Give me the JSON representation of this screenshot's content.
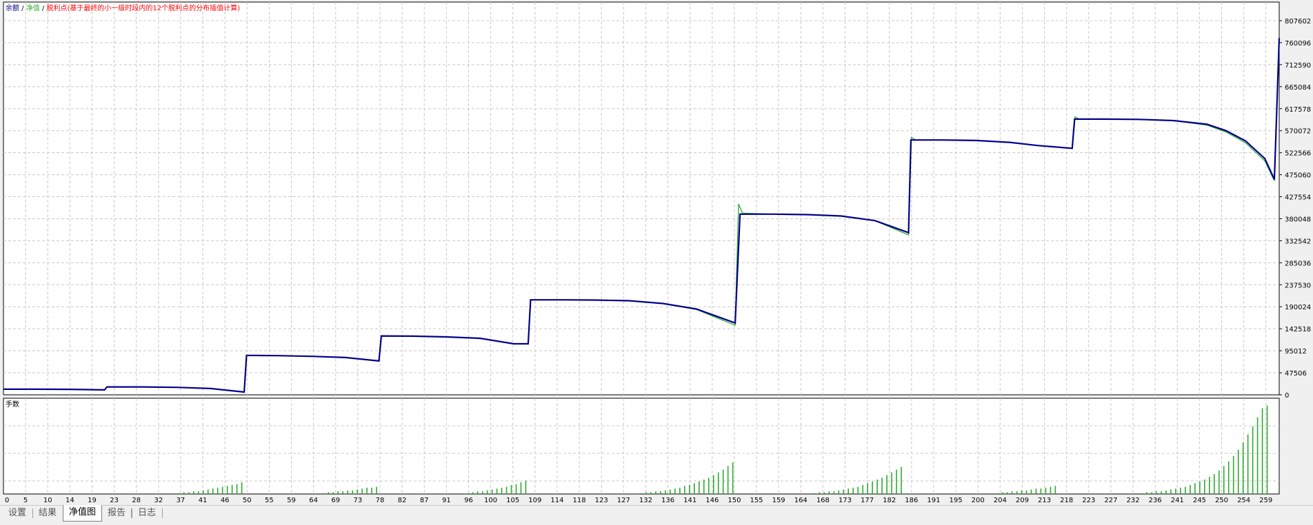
{
  "chart_data": [
    {
      "type": "line",
      "legend": [
        "余额",
        "净值",
        "脱利点(基于最终的小一级时段内的12个脱利点的分布插值计算)"
      ],
      "colors": {
        "balance": "#00008b",
        "equity": "#2ea82e",
        "legend_sep": "#000000",
        "legend_note": "#ff0000"
      },
      "grid": true,
      "x_ticks": [
        "0",
        "5",
        "10",
        "14",
        "19",
        "23",
        "28",
        "32",
        "37",
        "41",
        "46",
        "50",
        "55",
        "59",
        "64",
        "69",
        "73",
        "78",
        "82",
        "87",
        "91",
        "96",
        "100",
        "105",
        "109",
        "114",
        "118",
        "123",
        "127",
        "132",
        "136",
        "141",
        "146",
        "150",
        "155",
        "159",
        "164",
        "168",
        "173",
        "177",
        "182",
        "186",
        "191",
        "195",
        "200",
        "204",
        "209",
        "213",
        "218",
        "223",
        "227",
        "232",
        "236",
        "241",
        "245",
        "250",
        "254",
        "259"
      ],
      "x_range": [
        0,
        265
      ],
      "y_ticks": [
        "807602",
        "760096",
        "712590",
        "665084",
        "617578",
        "570072",
        "522566",
        "475060",
        "427554",
        "380048",
        "332542",
        "285036",
        "237530",
        "190024",
        "142518",
        "95012",
        "47506",
        "0"
      ],
      "ylim": [
        0,
        807602
      ],
      "balance": {
        "x": [
          0,
          7,
          14,
          21,
          21.5,
          29,
          36,
          43,
          50,
          50.5,
          57,
          64,
          71,
          78,
          78.5,
          85,
          92,
          99,
          106,
          109,
          109.5,
          116,
          123,
          130,
          137,
          144,
          152,
          153,
          160,
          167,
          174,
          181,
          188,
          188.5,
          195,
          202,
          209,
          215,
          222,
          222.5,
          229,
          236,
          243,
          250,
          254,
          258,
          262,
          264,
          265
        ],
        "y": [
          12000,
          12000,
          11800,
          10500,
          17000,
          17000,
          16000,
          13500,
          6000,
          85000,
          84500,
          83000,
          80500,
          73000,
          127000,
          126500,
          125000,
          122000,
          110000,
          110000,
          205000,
          205000,
          204500,
          203000,
          197000,
          185000,
          155000,
          390000,
          390000,
          389000,
          386000,
          376000,
          350000,
          550000,
          550000,
          549000,
          545000,
          538000,
          532000,
          595000,
          595000,
          594500,
          592000,
          584000,
          570000,
          548000,
          510000,
          465000,
          770000
        ]
      },
      "equity": {
        "x": [
          0,
          7,
          14,
          21,
          21.5,
          29,
          36,
          43,
          50,
          50.5,
          57,
          64,
          71,
          78,
          78.5,
          85,
          92,
          99,
          106,
          109,
          109.5,
          116,
          123,
          130,
          137,
          144,
          152,
          152.7,
          153.5,
          160,
          167,
          174,
          181,
          188,
          188.6,
          189.5,
          195,
          202,
          209,
          215,
          222,
          222.6,
          223.5,
          229,
          236,
          243,
          250,
          254,
          258,
          262,
          264,
          265
        ],
        "y": [
          12000,
          12000,
          11800,
          10500,
          17000,
          17000,
          16000,
          13500,
          6000,
          85000,
          84500,
          83000,
          80500,
          73000,
          127000,
          126500,
          125000,
          122000,
          110000,
          110000,
          205000,
          205000,
          204500,
          203000,
          197000,
          184000,
          150000,
          412000,
          392000,
          390000,
          389000,
          386000,
          376000,
          345000,
          556000,
          550000,
          550000,
          549000,
          545000,
          538000,
          532000,
          600000,
          595000,
          595000,
          594500,
          592000,
          582000,
          567000,
          544000,
          505000,
          462000,
          770000
        ]
      },
      "title": ""
    },
    {
      "type": "bar",
      "label": "手数",
      "color": "#2ea82e",
      "ylim": [
        0,
        100
      ],
      "bars": [
        {
          "x": 36.5,
          "v": 1
        },
        {
          "x": 37.5,
          "v": 2
        },
        {
          "x": 38.5,
          "v": 2
        },
        {
          "x": 39.5,
          "v": 3
        },
        {
          "x": 40.5,
          "v": 3
        },
        {
          "x": 41.5,
          "v": 4
        },
        {
          "x": 42.5,
          "v": 5
        },
        {
          "x": 43.5,
          "v": 6
        },
        {
          "x": 44.5,
          "v": 7
        },
        {
          "x": 45.5,
          "v": 8
        },
        {
          "x": 46.5,
          "v": 9
        },
        {
          "x": 47.5,
          "v": 10
        },
        {
          "x": 48.5,
          "v": 11
        },
        {
          "x": 49.5,
          "v": 13
        },
        {
          "x": 66.5,
          "v": 1
        },
        {
          "x": 67.5,
          "v": 2
        },
        {
          "x": 68.5,
          "v": 2
        },
        {
          "x": 69.5,
          "v": 3
        },
        {
          "x": 70.5,
          "v": 3
        },
        {
          "x": 71.5,
          "v": 4
        },
        {
          "x": 72.5,
          "v": 4
        },
        {
          "x": 73.5,
          "v": 5
        },
        {
          "x": 74.5,
          "v": 6
        },
        {
          "x": 75.5,
          "v": 7
        },
        {
          "x": 76.5,
          "v": 7
        },
        {
          "x": 77.5,
          "v": 8
        },
        {
          "x": 96.5,
          "v": 1
        },
        {
          "x": 97.5,
          "v": 2
        },
        {
          "x": 98.5,
          "v": 3
        },
        {
          "x": 99.5,
          "v": 3
        },
        {
          "x": 100.5,
          "v": 4
        },
        {
          "x": 101.5,
          "v": 5
        },
        {
          "x": 102.5,
          "v": 6
        },
        {
          "x": 103.5,
          "v": 7
        },
        {
          "x": 104.5,
          "v": 8
        },
        {
          "x": 105.5,
          "v": 10
        },
        {
          "x": 106.5,
          "v": 11
        },
        {
          "x": 107.5,
          "v": 13
        },
        {
          "x": 108.5,
          "v": 15
        },
        {
          "x": 132.5,
          "v": 1
        },
        {
          "x": 133.5,
          "v": 2
        },
        {
          "x": 134.5,
          "v": 2
        },
        {
          "x": 135.5,
          "v": 3
        },
        {
          "x": 136.5,
          "v": 3
        },
        {
          "x": 137.5,
          "v": 4
        },
        {
          "x": 138.5,
          "v": 5
        },
        {
          "x": 139.5,
          "v": 6
        },
        {
          "x": 140.5,
          "v": 7
        },
        {
          "x": 141.5,
          "v": 9
        },
        {
          "x": 142.5,
          "v": 10
        },
        {
          "x": 143.5,
          "v": 12
        },
        {
          "x": 144.5,
          "v": 14
        },
        {
          "x": 145.5,
          "v": 16
        },
        {
          "x": 146.5,
          "v": 18
        },
        {
          "x": 147.5,
          "v": 21
        },
        {
          "x": 148.5,
          "v": 24
        },
        {
          "x": 149.5,
          "v": 27
        },
        {
          "x": 150.5,
          "v": 31
        },
        {
          "x": 151.5,
          "v": 35
        },
        {
          "x": 168.5,
          "v": 1
        },
        {
          "x": 169.5,
          "v": 2
        },
        {
          "x": 170.5,
          "v": 2
        },
        {
          "x": 171.5,
          "v": 3
        },
        {
          "x": 172.5,
          "v": 3
        },
        {
          "x": 173.5,
          "v": 4
        },
        {
          "x": 174.5,
          "v": 5
        },
        {
          "x": 175.5,
          "v": 6
        },
        {
          "x": 176.5,
          "v": 7
        },
        {
          "x": 177.5,
          "v": 8
        },
        {
          "x": 178.5,
          "v": 10
        },
        {
          "x": 179.5,
          "v": 12
        },
        {
          "x": 180.5,
          "v": 14
        },
        {
          "x": 181.5,
          "v": 16
        },
        {
          "x": 182.5,
          "v": 18
        },
        {
          "x": 183.5,
          "v": 21
        },
        {
          "x": 184.5,
          "v": 24
        },
        {
          "x": 185.5,
          "v": 27
        },
        {
          "x": 186.5,
          "v": 30
        },
        {
          "x": 206.5,
          "v": 1
        },
        {
          "x": 207.5,
          "v": 2
        },
        {
          "x": 208.5,
          "v": 2
        },
        {
          "x": 209.5,
          "v": 3
        },
        {
          "x": 210.5,
          "v": 3
        },
        {
          "x": 211.5,
          "v": 4
        },
        {
          "x": 212.5,
          "v": 4
        },
        {
          "x": 213.5,
          "v": 5
        },
        {
          "x": 214.5,
          "v": 6
        },
        {
          "x": 215.5,
          "v": 6
        },
        {
          "x": 216.5,
          "v": 7
        },
        {
          "x": 217.5,
          "v": 8
        },
        {
          "x": 218.5,
          "v": 9
        },
        {
          "x": 236.5,
          "v": 1
        },
        {
          "x": 237.5,
          "v": 2
        },
        {
          "x": 238.5,
          "v": 2
        },
        {
          "x": 239.5,
          "v": 3
        },
        {
          "x": 240.5,
          "v": 3
        },
        {
          "x": 241.5,
          "v": 4
        },
        {
          "x": 242.5,
          "v": 5
        },
        {
          "x": 243.5,
          "v": 6
        },
        {
          "x": 244.5,
          "v": 7
        },
        {
          "x": 245.5,
          "v": 8
        },
        {
          "x": 246.5,
          "v": 10
        },
        {
          "x": 247.5,
          "v": 12
        },
        {
          "x": 248.5,
          "v": 14
        },
        {
          "x": 249.5,
          "v": 16
        },
        {
          "x": 250.5,
          "v": 19
        },
        {
          "x": 251.5,
          "v": 22
        },
        {
          "x": 252.5,
          "v": 26
        },
        {
          "x": 253.5,
          "v": 31
        },
        {
          "x": 254.5,
          "v": 36
        },
        {
          "x": 255.5,
          "v": 42
        },
        {
          "x": 256.5,
          "v": 49
        },
        {
          "x": 257.5,
          "v": 57
        },
        {
          "x": 258.5,
          "v": 66
        },
        {
          "x": 259.5,
          "v": 75
        },
        {
          "x": 260.5,
          "v": 85
        },
        {
          "x": 261.5,
          "v": 95
        },
        {
          "x": 262.5,
          "v": 98
        }
      ]
    }
  ],
  "tabs": [
    {
      "label": "设置",
      "active": false
    },
    {
      "label": "结果",
      "active": false
    },
    {
      "label": "净值图",
      "active": true
    },
    {
      "label": "报告",
      "active": false
    },
    {
      "label": "日志",
      "active": false
    }
  ]
}
